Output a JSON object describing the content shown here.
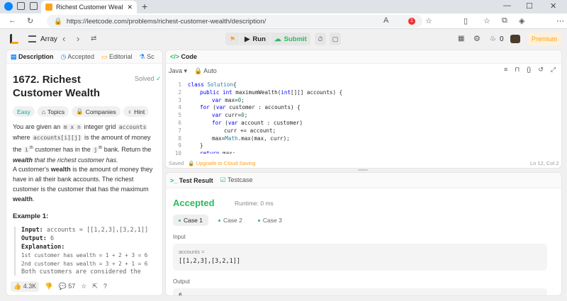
{
  "browser": {
    "tab_title": "Richest Customer Wealth - LeetC",
    "url": "https://leetcode.com/problems/richest-customer-wealth/description/",
    "notif_count": "1"
  },
  "toolbar": {
    "problem_list": "Array",
    "run_label": "Run",
    "submit_label": "Submit",
    "fire_count": "0",
    "premium_label": "Premium"
  },
  "left_tabs": [
    "Description",
    "Accepted",
    "Editorial",
    "Sc"
  ],
  "problem": {
    "title": "1672. Richest Customer Wealth",
    "status": "Solved",
    "difficulty": "Easy",
    "tags": [
      "Topics",
      "Companies",
      "Hint"
    ],
    "p1": {
      "a": "You are given an ",
      "grid": "m x n",
      "b": " integer grid ",
      "accounts": "accounts",
      "c": " where ",
      "accij": "accounts[i][j]",
      "d": " is the amount of money the ",
      "ith": "i",
      "sup1": "th",
      "e": " customer has in the ",
      "jth": "j",
      "sup2": "th",
      "f": " bank. Return the ",
      "wealth": "wealth",
      "g": " that the richest customer has."
    },
    "p2": {
      "a": "A customer's ",
      "wealth": "wealth",
      "b": " is the amount of money they have in all their bank accounts. The richest customer is the customer that has the maximum ",
      "wealth2": "wealth",
      "c": "."
    },
    "example_title": "Example 1:",
    "example": {
      "input_label": "Input:",
      "input_value": " accounts = [[1,2,3],[3,2,1]]",
      "output_label": "Output:",
      "output_value": " 6",
      "explanation_label": "Explanation:",
      "line1": "1st customer has wealth = 1 + 2 + 3 = 6",
      "line2": "2nd customer has wealth = 3 + 2 + 1 = 6",
      "line3": "Both customers are considered the"
    }
  },
  "left_footer": {
    "likes": "4.3K",
    "comments": "57"
  },
  "code_panel": {
    "title": "Code",
    "language": "Java",
    "mode": "Auto",
    "saved": "Saved",
    "upgrade": "Upgrade to Cloud Saving",
    "position": "Ln 12, Col 2",
    "line_numbers": [
      "1",
      "2",
      "3",
      "4",
      "5",
      "6",
      "7",
      "8",
      "9",
      "10"
    ],
    "lines": [
      {
        "indent": 0,
        "parts": [
          [
            "kw",
            "class "
          ],
          [
            "ty",
            "Solution"
          ],
          [
            "",
            "{"
          ]
        ]
      },
      {
        "indent": 1,
        "parts": [
          [
            "kw",
            "public int "
          ],
          [
            "",
            "maximumWealth("
          ],
          [
            "kw",
            "int"
          ],
          [
            "",
            "[][] accounts) {"
          ]
        ]
      },
      {
        "indent": 2,
        "parts": [
          [
            "kw",
            "var "
          ],
          [
            "",
            "max="
          ],
          [
            "nm",
            "0"
          ],
          [
            "",
            ";"
          ]
        ]
      },
      {
        "indent": 1,
        "parts": [
          [
            "kw",
            "for "
          ],
          [
            "",
            "("
          ],
          [
            "kw",
            "var "
          ],
          [
            "",
            "customer : accounts) {"
          ]
        ]
      },
      {
        "indent": 2,
        "parts": [
          [
            "kw",
            "var "
          ],
          [
            "",
            "curr="
          ],
          [
            "nm",
            "0"
          ],
          [
            "",
            ";"
          ]
        ]
      },
      {
        "indent": 2,
        "parts": [
          [
            "kw",
            "for "
          ],
          [
            "",
            "("
          ],
          [
            "kw",
            "var "
          ],
          [
            "",
            "account : customer)"
          ]
        ]
      },
      {
        "indent": 3,
        "parts": [
          [
            "",
            "curr += account;"
          ]
        ]
      },
      {
        "indent": 2,
        "parts": [
          [
            "",
            "max="
          ],
          [
            "ty",
            "Math"
          ],
          [
            "",
            ".max(max, curr);"
          ]
        ]
      },
      {
        "indent": 1,
        "parts": [
          [
            "",
            "}"
          ]
        ]
      },
      {
        "indent": 1,
        "parts": [
          [
            "kw",
            "return "
          ],
          [
            "",
            "max;"
          ]
        ]
      }
    ]
  },
  "result_panel": {
    "tab1": "Test Result",
    "tab2": "Testcase",
    "status": "Accepted",
    "runtime": "Runtime: 0 ms",
    "cases": [
      "Case 1",
      "Case 2",
      "Case 3"
    ],
    "input_heading": "Input",
    "var_name": "accounts =",
    "var_value": "[[1,2,3],[3,2,1]]",
    "output_heading": "Output",
    "output_value": "6"
  },
  "colors": {
    "accent": "#ffa116",
    "green": "#2cbb5d",
    "blue": "#0a84ff"
  }
}
